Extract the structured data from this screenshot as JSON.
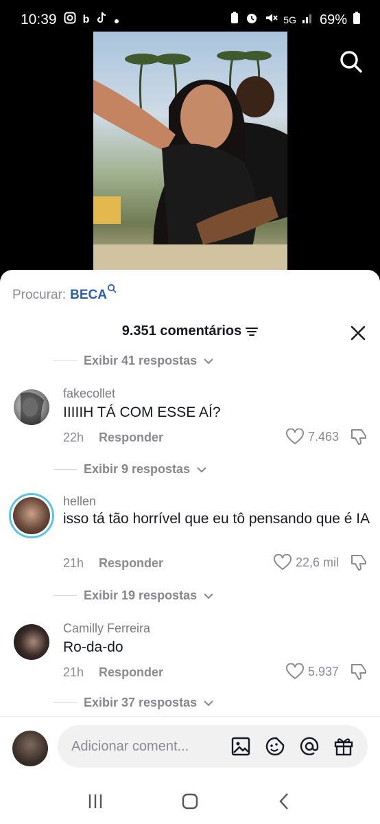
{
  "status_bar": {
    "time": "10:39",
    "battery": "69%",
    "network": "5G",
    "app_icons": [
      "instagram-icon",
      "bing-icon",
      "tiktok-icon",
      "dot-icon"
    ],
    "sys_icons": [
      "battery-saver-icon",
      "alarm-icon",
      "mute-icon",
      "signal-icon",
      "battery-icon"
    ]
  },
  "search_suggestion": {
    "label": "Procurar:",
    "keyword": "BECA"
  },
  "comments_header": {
    "count_label": "9.351 comentários"
  },
  "reply_toggles": [
    "Exibir 41 respostas",
    "Exibir 9 respostas",
    "Exibir 19 respostas",
    "Exibir 37 respostas"
  ],
  "comments": [
    {
      "username": "fakecollet",
      "text": "IIIIIH TÁ COM ESSE AÍ?",
      "age": "22h",
      "reply_label": "Responder",
      "likes": "7.463"
    },
    {
      "username": "hellen",
      "text": "isso tá tão horrível que eu tô pensando que é IA",
      "age": "21h",
      "reply_label": "Responder",
      "likes": "22,6 mil"
    },
    {
      "username": "Camilly Ferreira",
      "text": "Ro-da-do",
      "age": "21h",
      "reply_label": "Responder",
      "likes": "5.937"
    }
  ],
  "input": {
    "placeholder": "Adicionar coment..."
  },
  "colors": {
    "keyword": "#2b5db3",
    "story_ring": "#5bc4e6",
    "muted_text": "#8a8b91"
  }
}
